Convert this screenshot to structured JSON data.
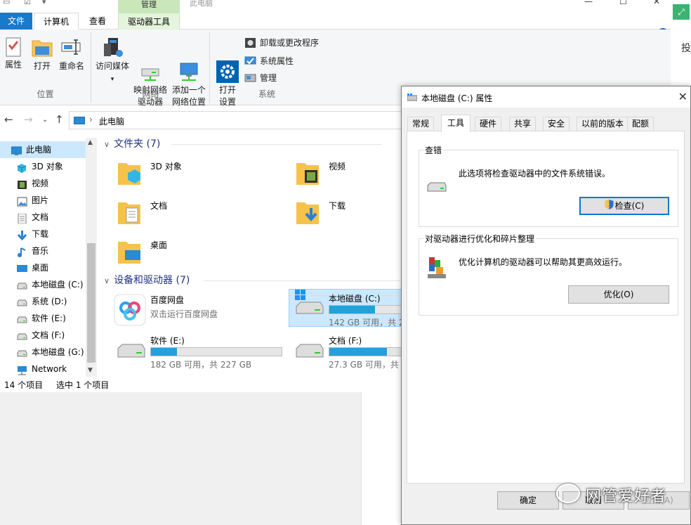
{
  "explorer": {
    "title": "此电脑",
    "manage_tab": "管理",
    "tabs": [
      "文件",
      "计算机",
      "查看",
      "驱动器工具"
    ],
    "ribbon": {
      "location": {
        "label": "位置",
        "buttons": [
          "属性",
          "打开",
          "重命名"
        ]
      },
      "network": {
        "label": "网络",
        "buttons": [
          "访问媒体",
          "映射网络\n驱动器",
          "添加一个\n网络位置"
        ]
      },
      "system": {
        "label": "系统",
        "open_settings": "打开\n设置",
        "small": [
          "卸载或更改程序",
          "系统属性",
          "管理"
        ]
      }
    },
    "address": {
      "path": "此电脑"
    },
    "sidebar": [
      {
        "label": "此电脑",
        "icon": "pc-icon",
        "selected": true
      },
      {
        "label": "3D 对象",
        "icon": "cube-icon"
      },
      {
        "label": "视频",
        "icon": "video-icon"
      },
      {
        "label": "图片",
        "icon": "picture-icon"
      },
      {
        "label": "文档",
        "icon": "document-icon"
      },
      {
        "label": "下载",
        "icon": "download-icon"
      },
      {
        "label": "音乐",
        "icon": "music-icon"
      },
      {
        "label": "桌面",
        "icon": "desktop-icon"
      },
      {
        "label": "本地磁盘 (C:)",
        "icon": "drive-icon"
      },
      {
        "label": "系统 (D:)",
        "icon": "drive-icon"
      },
      {
        "label": "软件 (E:)",
        "icon": "drive-icon"
      },
      {
        "label": "文档 (F:)",
        "icon": "drive-icon"
      },
      {
        "label": "本地磁盘 (G:)",
        "icon": "drive-icon"
      },
      {
        "label": "Network",
        "icon": "network-icon"
      }
    ],
    "folders_header": "文件夹 (7)",
    "folders": [
      "3D 对象",
      "视频",
      "文档",
      "下载",
      "桌面"
    ],
    "devices_header": "设备和驱动器 (7)",
    "devices": [
      {
        "name": "百度网盘",
        "sub": "双击运行百度网盘"
      },
      {
        "name": "本地磁盘 (C:)",
        "caption": "142 GB 可用，共 2",
        "used": 0.6
      },
      {
        "name": "软件 (E:)",
        "caption": "182 GB 可用，共 227 GB",
        "used": 0.2
      },
      {
        "name": "文档 (F:)",
        "caption": "27.3 GB 可用，共 2",
        "used": 0.75
      }
    ],
    "status": {
      "count": "14 个项目",
      "selected": "选中 1 个项目"
    }
  },
  "dialog": {
    "title": "本地磁盘 (C:) 属性",
    "tabs": [
      "常规",
      "工具",
      "硬件",
      "共享",
      "安全",
      "以前的版本",
      "配额"
    ],
    "check": {
      "title": "查错",
      "text": "此选项将检查驱动器中的文件系统错误。",
      "button": "检查(C)"
    },
    "optimize": {
      "title": "对驱动器进行优化和碎片整理",
      "text": "优化计算机的驱动器可以帮助其更高效运行。",
      "button": "优化(O)"
    },
    "buttons": {
      "ok": "确定",
      "cancel": "取消",
      "apply": "应用(A)"
    }
  },
  "watermark": "网管爱好者",
  "edge_text": "投"
}
